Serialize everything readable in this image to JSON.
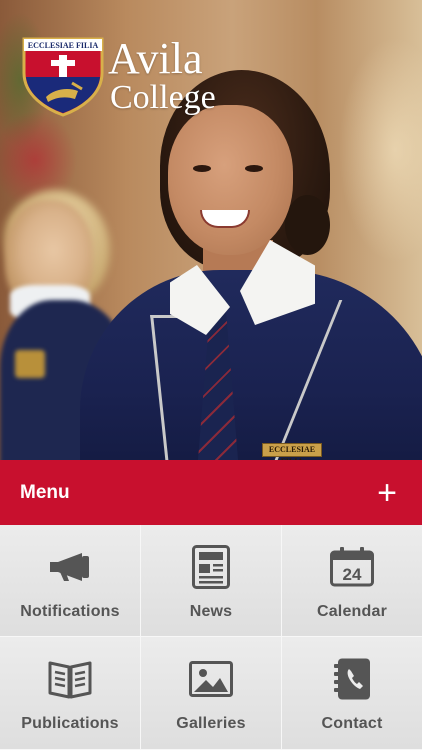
{
  "brand": {
    "crest_motto": "ECCLESIAE FILIA",
    "name_line1": "Avila",
    "name_line2": "College",
    "accent_color": "#c8102e"
  },
  "hero": {
    "pocket_badge": "ECCLESIAE FILIA"
  },
  "menu": {
    "title": "Menu",
    "expand_glyph": "+"
  },
  "tiles": [
    {
      "label": "Notifications",
      "icon": "megaphone-icon"
    },
    {
      "label": "News",
      "icon": "newspaper-icon"
    },
    {
      "label": "Calendar",
      "icon": "calendar-icon",
      "calendar_day": "24"
    },
    {
      "label": "Publications",
      "icon": "open-book-icon"
    },
    {
      "label": "Galleries",
      "icon": "image-icon"
    },
    {
      "label": "Contact",
      "icon": "phone-book-icon"
    }
  ]
}
